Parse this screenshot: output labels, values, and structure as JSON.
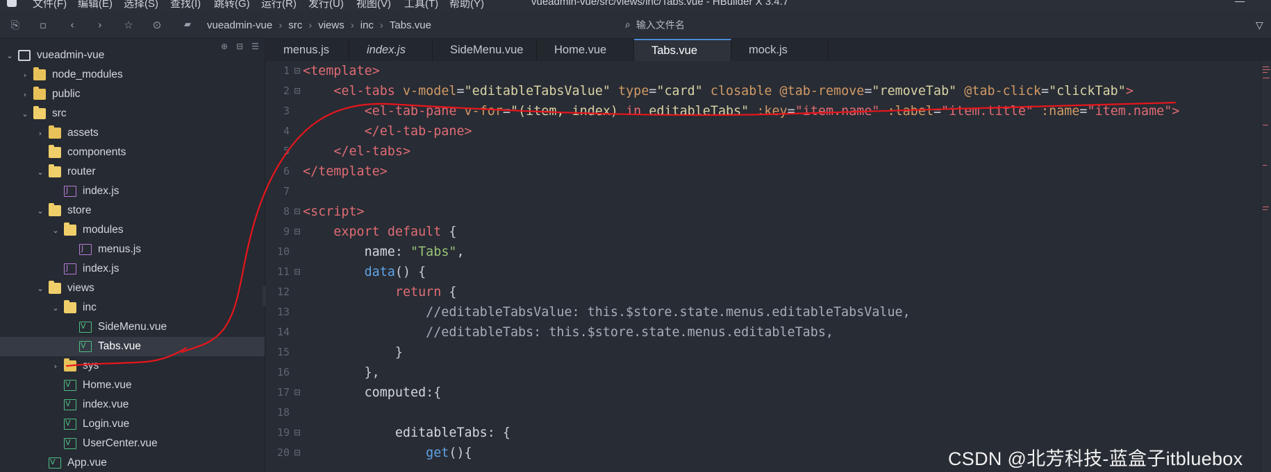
{
  "menubar": {
    "items": [
      "文件(F)",
      "编辑(E)",
      "选择(S)",
      "查找(I)",
      "跳转(G)",
      "运行(R)",
      "发行(U)",
      "视图(V)",
      "工具(T)",
      "帮助(Y)"
    ],
    "window_title": "vueadmin-vue/src/views/inc/Tabs.vue - HBuilder X 3.4.7"
  },
  "toolbar": {
    "icons": [
      "new-file-icon",
      "save-icon",
      "back-icon",
      "forward-icon",
      "star-icon",
      "run-icon"
    ],
    "breadcrumb": [
      "vueadmin-vue",
      "src",
      "views",
      "inc",
      "Tabs.vue"
    ],
    "search_placeholder": "输入文件名"
  },
  "sidebar": {
    "rows": [
      {
        "label": "vueadmin-vue",
        "icon": "project",
        "depth": 0,
        "chevron": "down"
      },
      {
        "label": "node_modules",
        "icon": "folder",
        "depth": 1,
        "chevron": "right"
      },
      {
        "label": "public",
        "icon": "folder",
        "depth": 1,
        "chevron": "right"
      },
      {
        "label": "src",
        "icon": "folder-open",
        "depth": 1,
        "chevron": "down"
      },
      {
        "label": "assets",
        "icon": "folder",
        "depth": 2,
        "chevron": "right"
      },
      {
        "label": "components",
        "icon": "folder-open",
        "depth": 2,
        "chevron": ""
      },
      {
        "label": "router",
        "icon": "folder-open",
        "depth": 2,
        "chevron": "down"
      },
      {
        "label": "index.js",
        "icon": "js",
        "depth": 3,
        "chevron": ""
      },
      {
        "label": "store",
        "icon": "folder-open",
        "depth": 2,
        "chevron": "down"
      },
      {
        "label": "modules",
        "icon": "folder-open",
        "depth": 3,
        "chevron": "down"
      },
      {
        "label": "menus.js",
        "icon": "js",
        "depth": 4,
        "chevron": ""
      },
      {
        "label": "index.js",
        "icon": "js",
        "depth": 3,
        "chevron": ""
      },
      {
        "label": "views",
        "icon": "folder-open",
        "depth": 2,
        "chevron": "down"
      },
      {
        "label": "inc",
        "icon": "folder-open",
        "depth": 3,
        "chevron": "down"
      },
      {
        "label": "SideMenu.vue",
        "icon": "vue",
        "depth": 4,
        "chevron": ""
      },
      {
        "label": "Tabs.vue",
        "icon": "vue",
        "depth": 4,
        "chevron": "",
        "selected": true
      },
      {
        "label": "sys",
        "icon": "folder",
        "depth": 3,
        "chevron": "right"
      },
      {
        "label": "Home.vue",
        "icon": "vue",
        "depth": 3,
        "chevron": ""
      },
      {
        "label": "index.vue",
        "icon": "vue",
        "depth": 3,
        "chevron": ""
      },
      {
        "label": "Login.vue",
        "icon": "vue",
        "depth": 3,
        "chevron": ""
      },
      {
        "label": "UserCenter.vue",
        "icon": "vue",
        "depth": 3,
        "chevron": ""
      },
      {
        "label": "App.vue",
        "icon": "vue",
        "depth": 2,
        "chevron": ""
      }
    ]
  },
  "tabs": [
    {
      "label": "menus.js",
      "italic": false,
      "active": false
    },
    {
      "label": "index.js",
      "italic": true,
      "active": false
    },
    {
      "label": "SideMenu.vue",
      "italic": false,
      "active": false
    },
    {
      "label": "Home.vue",
      "italic": false,
      "active": false
    },
    {
      "label": "Tabs.vue",
      "italic": false,
      "active": true
    },
    {
      "label": "mock.js",
      "italic": false,
      "active": false
    }
  ],
  "code": [
    {
      "n": "1",
      "fold": "⊟",
      "tokens": [
        [
          "tag",
          "<template>"
        ]
      ]
    },
    {
      "n": "2",
      "fold": "⊟",
      "tokens": [
        [
          "id",
          "    "
        ],
        [
          "tag",
          "<el-tabs"
        ],
        [
          "id",
          " "
        ],
        [
          "attr",
          "v-model"
        ],
        [
          "punct",
          "="
        ],
        [
          "str",
          "\"editableTabsValue\""
        ],
        [
          "id",
          " "
        ],
        [
          "attr",
          "type"
        ],
        [
          "punct",
          "="
        ],
        [
          "str",
          "\"card\""
        ],
        [
          "id",
          " "
        ],
        [
          "attr",
          "closable"
        ],
        [
          "id",
          " "
        ],
        [
          "attr",
          "@tab-remove"
        ],
        [
          "punct",
          "="
        ],
        [
          "str",
          "\"removeTab\""
        ],
        [
          "id",
          " "
        ],
        [
          "attr",
          "@tab-click"
        ],
        [
          "punct",
          "="
        ],
        [
          "str",
          "\"clickTab\""
        ],
        [
          "tag",
          ">"
        ]
      ]
    },
    {
      "n": "3",
      "fold": "",
      "tokens": [
        [
          "id",
          "        "
        ],
        [
          "tag",
          "<el-tab-pane"
        ],
        [
          "id",
          " "
        ],
        [
          "attr",
          "v-for"
        ],
        [
          "punct",
          "="
        ],
        [
          "str",
          "\"(item, index) "
        ],
        [
          "kw",
          "in"
        ],
        [
          "str",
          " editableTabs\""
        ],
        [
          "id",
          " "
        ],
        [
          "attr",
          ":key"
        ],
        [
          "punct",
          "="
        ],
        [
          "tag",
          "\"item.name\""
        ],
        [
          "id",
          " "
        ],
        [
          "attr",
          ":label"
        ],
        [
          "punct",
          "="
        ],
        [
          "tag",
          "\"item.title\""
        ],
        [
          "id",
          " "
        ],
        [
          "attr",
          ":name"
        ],
        [
          "punct",
          "="
        ],
        [
          "tag",
          "\"item.name\""
        ],
        [
          "tag",
          ">"
        ]
      ]
    },
    {
      "n": "4",
      "fold": "",
      "tokens": [
        [
          "id",
          "        "
        ],
        [
          "tag",
          "</el-tab-pane>"
        ]
      ]
    },
    {
      "n": "5",
      "fold": "",
      "tokens": [
        [
          "id",
          "    "
        ],
        [
          "tag",
          "</el-tabs>"
        ]
      ]
    },
    {
      "n": "6",
      "fold": "",
      "tokens": [
        [
          "tag",
          "</template>"
        ]
      ]
    },
    {
      "n": "7",
      "fold": "",
      "tokens": []
    },
    {
      "n": "8",
      "fold": "⊟",
      "tokens": [
        [
          "tag",
          "<script>"
        ]
      ]
    },
    {
      "n": "9",
      "fold": "⊟",
      "tokens": [
        [
          "id",
          "    "
        ],
        [
          "kw",
          "export"
        ],
        [
          "id",
          " "
        ],
        [
          "kw",
          "default"
        ],
        [
          "punct",
          " {"
        ]
      ]
    },
    {
      "n": "10",
      "fold": "",
      "tokens": [
        [
          "id",
          "        name"
        ],
        [
          "punct",
          ": "
        ],
        [
          "green",
          "\"Tabs\""
        ],
        [
          "punct",
          ","
        ]
      ]
    },
    {
      "n": "11",
      "fold": "⊟",
      "tokens": [
        [
          "id",
          "        "
        ],
        [
          "fn",
          "data"
        ],
        [
          "punct",
          "() {"
        ]
      ]
    },
    {
      "n": "12",
      "fold": "",
      "tokens": [
        [
          "id",
          "            "
        ],
        [
          "kw",
          "return"
        ],
        [
          "punct",
          " {"
        ]
      ]
    },
    {
      "n": "13",
      "fold": "",
      "tokens": [
        [
          "comment",
          "                //editableTabsValue: this.$store.state.menus.editableTabsValue,"
        ]
      ]
    },
    {
      "n": "14",
      "fold": "",
      "tokens": [
        [
          "comment",
          "                //editableTabs: this.$store.state.menus.editableTabs,"
        ]
      ]
    },
    {
      "n": "15",
      "fold": "",
      "tokens": [
        [
          "punct",
          "            }"
        ]
      ]
    },
    {
      "n": "16",
      "fold": "",
      "tokens": [
        [
          "punct",
          "        },"
        ]
      ]
    },
    {
      "n": "17",
      "fold": "⊟",
      "tokens": [
        [
          "id",
          "        computed"
        ],
        [
          "punct",
          ":{"
        ]
      ]
    },
    {
      "n": "18",
      "fold": "",
      "tokens": []
    },
    {
      "n": "19",
      "fold": "⊟",
      "tokens": [
        [
          "id",
          "            editableTabs"
        ],
        [
          "punct",
          ": {"
        ]
      ]
    },
    {
      "n": "20",
      "fold": "⊟",
      "tokens": [
        [
          "id",
          "                "
        ],
        [
          "fn",
          "get"
        ],
        [
          "punct",
          "(){"
        ]
      ]
    }
  ],
  "watermark": "CSDN @北芳科技-蓝盒子itbluebox",
  "colors": {
    "annotation": "#e8161c",
    "tab_active_border": "#4c8dd8"
  }
}
